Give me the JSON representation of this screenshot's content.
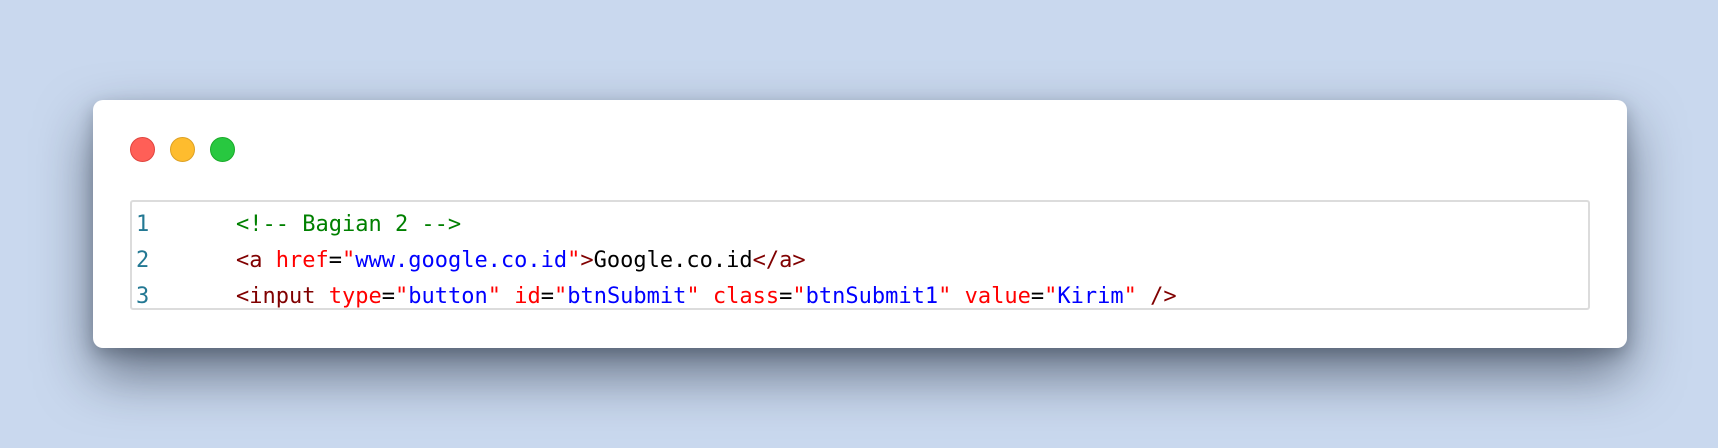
{
  "editor": {
    "lines": [
      {
        "number": "1",
        "tokens": [
          {
            "type": "comment",
            "text": "<!-- Bagian 2 -->"
          }
        ]
      },
      {
        "number": "2",
        "tokens": [
          {
            "type": "tag",
            "text": "<a"
          },
          {
            "type": "txt",
            "text": " "
          },
          {
            "type": "attr",
            "text": "href"
          },
          {
            "type": "txt",
            "text": "="
          },
          {
            "type": "attr",
            "text": "\""
          },
          {
            "type": "val",
            "text": "www.google.co.id"
          },
          {
            "type": "attr",
            "text": "\""
          },
          {
            "type": "tag",
            "text": ">"
          },
          {
            "type": "txt",
            "text": "Google.co.id"
          },
          {
            "type": "tag",
            "text": "</a>"
          }
        ]
      },
      {
        "number": "3",
        "tokens": [
          {
            "type": "tag",
            "text": "<input"
          },
          {
            "type": "txt",
            "text": " "
          },
          {
            "type": "attr",
            "text": "type"
          },
          {
            "type": "txt",
            "text": "="
          },
          {
            "type": "attr",
            "text": "\""
          },
          {
            "type": "val",
            "text": "button"
          },
          {
            "type": "attr",
            "text": "\""
          },
          {
            "type": "txt",
            "text": " "
          },
          {
            "type": "attr",
            "text": "id"
          },
          {
            "type": "txt",
            "text": "="
          },
          {
            "type": "attr",
            "text": "\""
          },
          {
            "type": "val",
            "text": "btnSubmit"
          },
          {
            "type": "attr",
            "text": "\""
          },
          {
            "type": "txt",
            "text": " "
          },
          {
            "type": "attr",
            "text": "class"
          },
          {
            "type": "txt",
            "text": "="
          },
          {
            "type": "attr",
            "text": "\""
          },
          {
            "type": "val",
            "text": "btnSubmit1"
          },
          {
            "type": "attr",
            "text": "\""
          },
          {
            "type": "txt",
            "text": " "
          },
          {
            "type": "attr",
            "text": "value"
          },
          {
            "type": "txt",
            "text": "="
          },
          {
            "type": "attr",
            "text": "\""
          },
          {
            "type": "val",
            "text": "Kirim"
          },
          {
            "type": "attr",
            "text": "\""
          },
          {
            "type": "txt",
            "text": " "
          },
          {
            "type": "tag",
            "text": "/>"
          }
        ]
      }
    ]
  }
}
